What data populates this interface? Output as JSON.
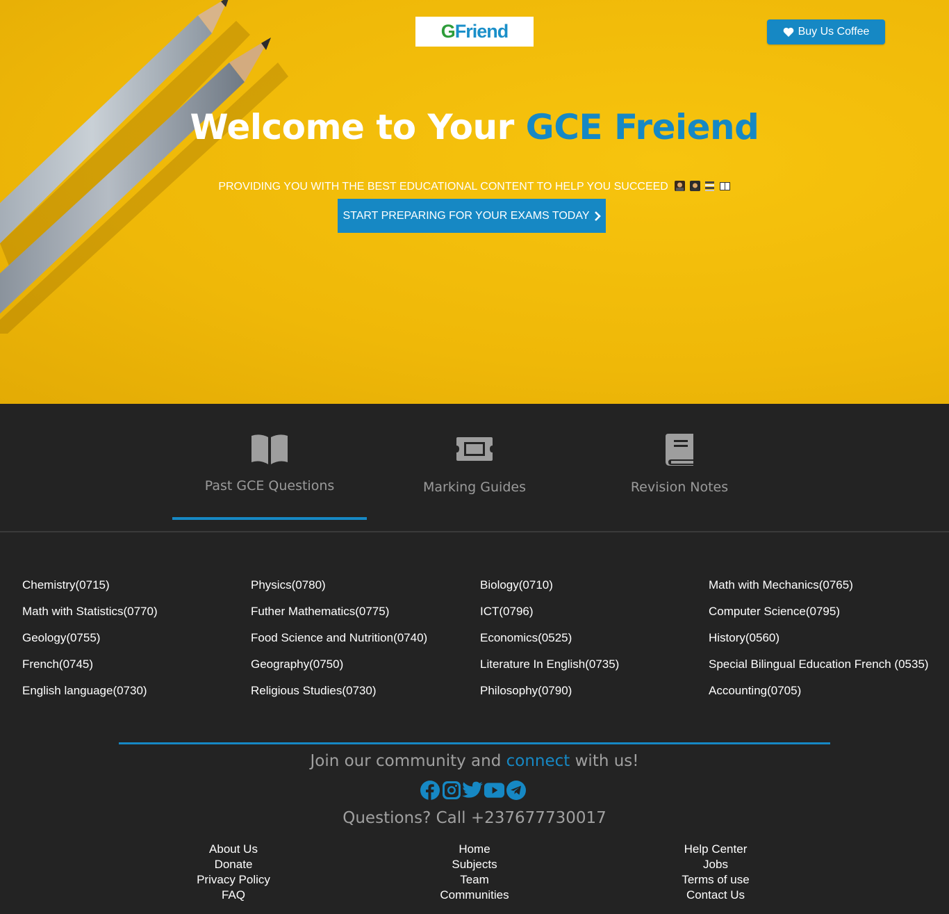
{
  "header": {
    "logo_text_g": "G",
    "logo_text_rest": "Friend",
    "coffee_label": "Buy Us Coffee"
  },
  "hero": {
    "title_prefix": "Welcome to Your ",
    "title_accent": "GCE Freiend",
    "subtitle": "PROVIDING YOU WITH THE BEST EDUCATIONAL CONTENT TO HELP YOU SUCCEED",
    "subtitle_emojis": [
      "student-emoji",
      "graduate-emoji",
      "books-emoji",
      "open-book-emoji"
    ],
    "cta_label": "START PREPARING FOR YOUR EXAMS TODAY"
  },
  "tabs": [
    {
      "label": "Past GCE Questions",
      "icon": "open-book-icon",
      "active": true
    },
    {
      "label": "Marking Guides",
      "icon": "ticket-icon",
      "active": false
    },
    {
      "label": "Revision Notes",
      "icon": "book-icon",
      "active": false
    }
  ],
  "subjects": {
    "col1": [
      "Chemistry(0715)",
      "Math with Statistics(0770)",
      "Geology(0755)",
      "French(0745)",
      "English language(0730)"
    ],
    "col2": [
      "Physics(0780)",
      "Futher Mathematics(0775)",
      "Food Science and Nutrition(0740)",
      "Geography(0750)",
      "Religious Studies(0730)"
    ],
    "col3": [
      "Biology(0710)",
      "ICT(0796)",
      "Economics(0525)",
      "Literature In English(0735)",
      "Philosophy(0790)"
    ],
    "col4": [
      "Math with Mechanics(0765)",
      "Computer Science(0795)",
      "History(0560)",
      "Special Bilingual Education French (0535)",
      "Accounting(0705)"
    ]
  },
  "footer": {
    "join_prefix": "Join our community and ",
    "join_accent": "connect",
    "join_suffix": " with us!",
    "socials": [
      "facebook-icon",
      "instagram-icon",
      "twitter-icon",
      "youtube-icon",
      "telegram-icon"
    ],
    "phone": "Questions? Call +237677730017",
    "links_col1": [
      "About Us",
      "Donate",
      "Privacy Policy",
      "FAQ"
    ],
    "links_col2": [
      "Home",
      "Subjects",
      "Team",
      "Communities"
    ],
    "links_col3": [
      "Help Center",
      "Jobs",
      "Terms of use",
      "Contact Us"
    ]
  },
  "colors": {
    "accent": "#1688c4",
    "hero_bg": "#f2bb0a",
    "dark_bg": "#232323",
    "muted_text": "#9b9b9b"
  }
}
